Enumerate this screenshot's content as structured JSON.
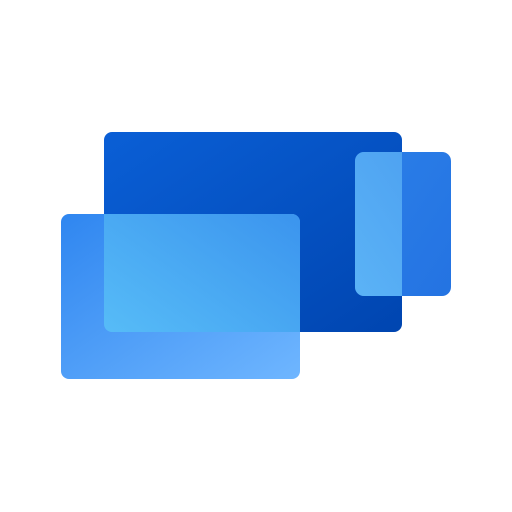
{
  "icon": {
    "name": "windows-app-overlapping-screens-logo",
    "description_text": ""
  },
  "colors": {
    "background": "#ffffff",
    "back_panel_top": "#0A5FD6",
    "back_panel_bottom": "#0045B0",
    "front_panel_left": "#2F86F0",
    "front_panel_right": "#6FB6FF",
    "overlap_glass_left": "#5FC8FA",
    "overlap_glass_right": "#3B94EE",
    "right_card": "#2B7FE8",
    "right_card_overlap": "#5BB3F6"
  }
}
